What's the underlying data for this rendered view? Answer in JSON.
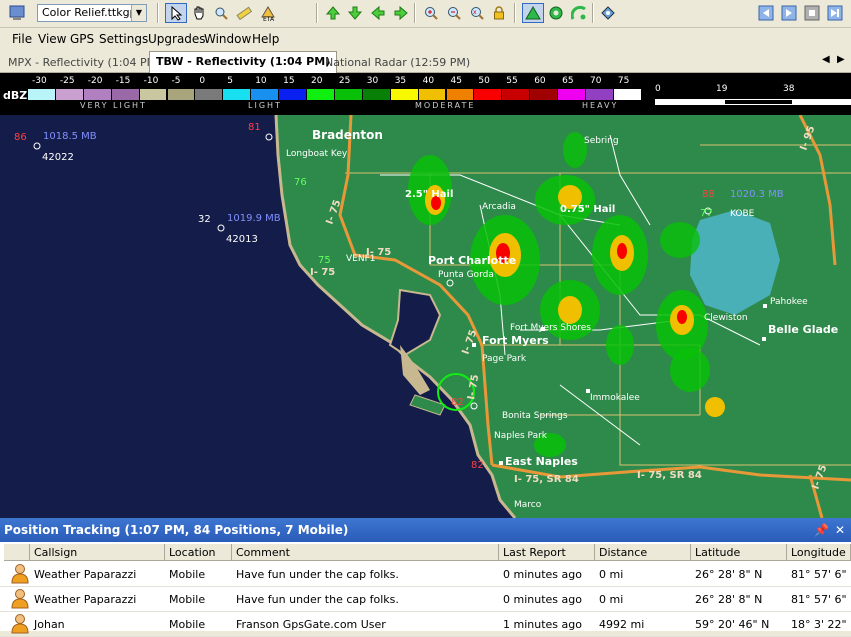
{
  "toolbar": {
    "map_file": "Color Relief.ttkgp"
  },
  "menu": [
    "File",
    "View",
    "GPS",
    "Settings",
    "Upgrades",
    "Window",
    "Help"
  ],
  "tabs": [
    {
      "label": "MPX - Reflectivity (1:04 PM)",
      "active": false
    },
    {
      "label": "TBW - Reflectivity (1:04 PM)",
      "active": true
    },
    {
      "label": "National Radar (12:59 PM)",
      "active": false
    }
  ],
  "legend": {
    "unit": "dBZ",
    "ticks": [
      "-30",
      "-25",
      "-20",
      "-15",
      "-10",
      "-5",
      "0",
      "5",
      "10",
      "15",
      "20",
      "25",
      "30",
      "35",
      "40",
      "45",
      "50",
      "55",
      "60",
      "65",
      "70",
      "75"
    ],
    "colors": [
      "#b8f4f8",
      "#c9a0d0",
      "#b080c0",
      "#9a6aa8",
      "#c9c7a0",
      "#a8a47c",
      "#7a7a7a",
      "#18e0f0",
      "#1890f0",
      "#0a20f0",
      "#10f010",
      "#08c008",
      "#088008",
      "#f8f800",
      "#f0c000",
      "#f08000",
      "#f80000",
      "#c80000",
      "#a00000",
      "#f000f0",
      "#9040c0",
      "#ffffff"
    ],
    "categories": [
      "VERY LIGHT",
      "LIGHT",
      "MODERATE",
      "HEAVY"
    ],
    "scale_ticks": [
      "0",
      "19",
      "38"
    ]
  },
  "map": {
    "cities": [
      {
        "name": "Bradenton"
      },
      {
        "name": "Longboat Key"
      },
      {
        "name": "Sebring"
      },
      {
        "name": "Arcadia"
      },
      {
        "name": "Port Charlotte"
      },
      {
        "name": "Punta Gorda"
      },
      {
        "name": "Fort Myers Shores"
      },
      {
        "name": "Fort Myers"
      },
      {
        "name": "Page Park"
      },
      {
        "name": "Clewiston"
      },
      {
        "name": "Pahokee"
      },
      {
        "name": "Belle Glade"
      },
      {
        "name": "Immokalee"
      },
      {
        "name": "Bonita Springs"
      },
      {
        "name": "Naples Park"
      },
      {
        "name": "East Naples"
      },
      {
        "name": "Marco"
      },
      {
        "name": "VENF1"
      },
      {
        "name": "KOBE"
      }
    ],
    "highways": [
      {
        "name": "I- 75"
      },
      {
        "name": "I- 75"
      },
      {
        "name": "I- 75"
      },
      {
        "name": "I- 75"
      },
      {
        "name": "I- 75"
      },
      {
        "name": "I- 75, SR 84"
      },
      {
        "name": "I- 75, SR 84"
      },
      {
        "name": "I- 95"
      },
      {
        "name": "I- 75"
      }
    ],
    "hail": [
      {
        "label": "2.5\" Hail"
      },
      {
        "label": "0.75\" Hail"
      }
    ],
    "buoys": [
      {
        "temp": "86",
        "pressure": "1018.5 MB",
        "id": "42022"
      },
      {
        "temp": "32",
        "pressure": "1019.9 MB",
        "id": "42013"
      },
      {
        "temp": "88",
        "pressure": "1020.3 MB",
        "id": "KOBE"
      }
    ],
    "temps": [
      "81",
      "76",
      "75",
      "77",
      "82",
      "82"
    ],
    "colors": {
      "sea": "#141c4a",
      "land": "#2e8a4a",
      "shore": "#c8b890",
      "highway": "#e89838",
      "county": "#d8c070",
      "lake": "#4ab0b8"
    }
  },
  "panel": {
    "title": "Position Tracking (1:07 PM, 84 Positions, 7 Mobile)",
    "columns": [
      "Callsign",
      "Location",
      "Comment",
      "Last Report",
      "Distance",
      "Latitude",
      "Longitude"
    ],
    "rows": [
      [
        "Weather Paparazzi",
        "Mobile",
        "Have fun under the cap folks.",
        "0 minutes ago",
        "0 mi",
        "26° 28' 8\" N",
        "81° 57' 6\""
      ],
      [
        "Weather Paparazzi",
        "Mobile",
        "Have fun under the cap folks.",
        "0 minutes ago",
        "0 mi",
        "26° 28' 8\" N",
        "81° 57' 6\""
      ],
      [
        "Johan",
        "Mobile",
        "Franson GpsGate.com User",
        "1 minutes ago",
        "4992 mi",
        "59° 20' 46\" N",
        "18° 3' 22\""
      ]
    ]
  }
}
